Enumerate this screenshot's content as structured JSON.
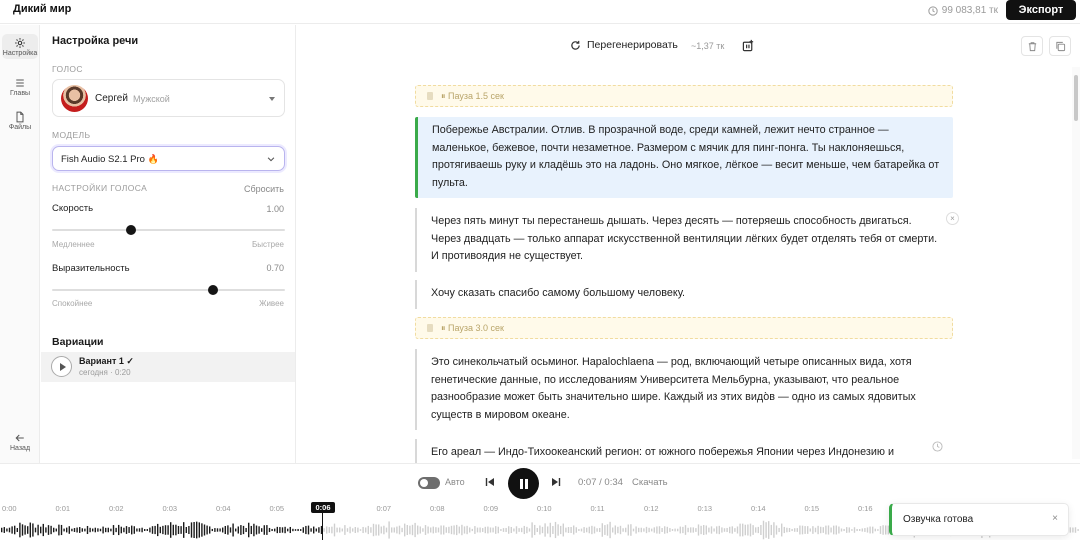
{
  "app": {
    "title": "Дикий мир",
    "balance": "99 083,81 тк",
    "export_label": "Экспорт"
  },
  "rail": {
    "items": [
      {
        "label": "Настройка",
        "icon": "gear-icon"
      },
      {
        "label": "Главы",
        "icon": "list-icon"
      },
      {
        "label": "Файлы",
        "icon": "file-icon"
      }
    ],
    "back_label": "Назад"
  },
  "panel": {
    "title": "Настройка речи",
    "voice_section": "Голос",
    "voice": {
      "name": "Сергей",
      "gender": "Мужской"
    },
    "model_section": "Модель",
    "model": {
      "name": "Fish Audio S2.1 Pro",
      "badge": "🔥"
    },
    "voice_settings_section": "Настройки голоса",
    "reset_label": "Сбросить",
    "speed": {
      "label": "Скорость",
      "value": "1.00",
      "min_label": "Медленнее",
      "max_label": "Быстрее",
      "level": 0.34
    },
    "expressiveness": {
      "label": "Выразительность",
      "value": "0.70",
      "min_label": "Спокойнее",
      "max_label": "Живее",
      "level": 0.69
    },
    "variations_title": "Вариации",
    "variant": {
      "name": "Вариант 1 ✓",
      "meta": "сегодня · 0:20"
    }
  },
  "main": {
    "regenerate_label": "Перегенерировать",
    "regenerate_cost": "~1,37 тк",
    "blocks": {
      "pause1": "Пауза 1.5 сек",
      "p1": "Побережье Австралии. Отлив. В прозрачной воде, среди камней, лежит нечто странное — маленькое, бежевое, почти незаметное. Размером с мячик для пинг-понга. Ты наклоняешься, протягиваешь руку и кладёшь это на ладонь. Оно мягкое, лёгкое — весит меньше, чем батарейка от пульта.",
      "p2": "Через пять минут ты перестанешь дышать. Через десять — потеряешь способность двигаться. Через двадцать — только аппарат искусственной вентиляции лёгких будет отделять тебя от смерти. И противоядия не существует.",
      "p3": "Хочу сказать спасибо самому большому человеку.",
      "pause2": "Пауза 3.0 сек",
      "p4": "Это синекольчатый осьминог. Hapalochlaena — род, включающий четыре описанных вида, хотя генетические данные, по исследованиям Университета Мельбурна, указывают, что реальное разнообразие может быть значительно шире. Каждый из этих видо̀в — одно из самых ядовитых существ в мировом океане.",
      "p5": "Его ареал — Индо-Тихоокеанский регион: от южного побережья Японии через Индонезию и"
    }
  },
  "player": {
    "auto_label": "Авто",
    "time": "0:07 / 0:34",
    "download_label": "Скачать",
    "playhead_label": "0:06",
    "ticks": [
      "0:00",
      "0:01",
      "0:02",
      "0:03",
      "0:04",
      "0:05",
      "0:06",
      "0:07",
      "0:08",
      "0:09",
      "0:10",
      "0:11",
      "0:12",
      "0:13",
      "0:14",
      "0:15",
      "0:16"
    ],
    "progress": 0.21
  },
  "toast": {
    "text": "Озвучка готова",
    "close": "×"
  },
  "colors": {
    "accent_green": "#3aaa4a",
    "active_block": "#e8f2fd",
    "pause_bg": "#fffaea",
    "primary": "#111111"
  }
}
